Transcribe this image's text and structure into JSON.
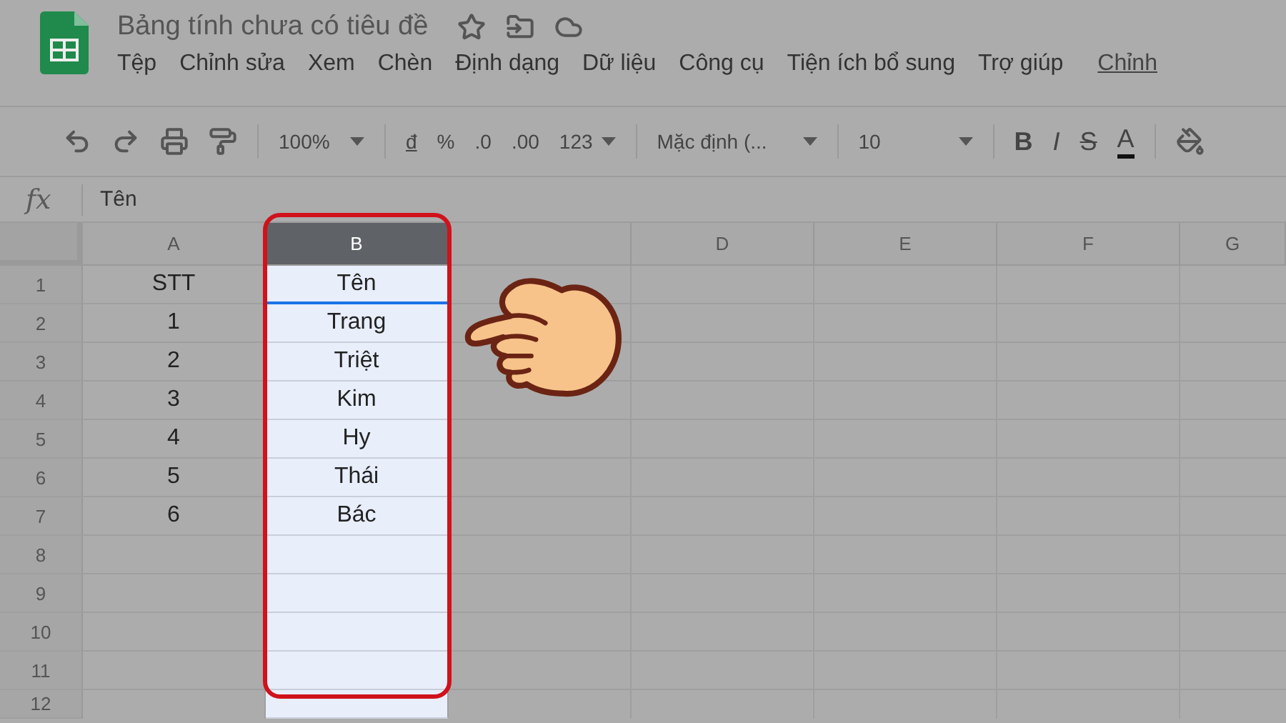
{
  "document": {
    "title": "Bảng tính chưa có tiêu đề"
  },
  "menu": [
    {
      "label": "Tệp"
    },
    {
      "label": "Chỉnh sửa"
    },
    {
      "label": "Xem"
    },
    {
      "label": "Chèn"
    },
    {
      "label": "Định dạng"
    },
    {
      "label": "Dữ liệu"
    },
    {
      "label": "Công cụ"
    },
    {
      "label": "Tiện ích bổ sung"
    },
    {
      "label": "Trợ giúp"
    }
  ],
  "edit_link": "Chỉnh",
  "toolbar": {
    "zoom": "100%",
    "currency": "đ",
    "percent": "%",
    "decrease_decimals": ".0",
    "increase_decimals": ".00",
    "number_format": "123",
    "font": "Mặc định (...",
    "font_size": "10",
    "bold": "B",
    "italic": "I",
    "strikethrough": "S",
    "text_color": "A"
  },
  "formula_bar": {
    "label": "fx",
    "value": "Tên"
  },
  "columns": [
    {
      "label": "A",
      "selected": false
    },
    {
      "label": "B",
      "selected": true
    },
    {
      "selected": false
    },
    {
      "label": "D",
      "selected": false
    },
    {
      "label": "E",
      "selected": false
    },
    {
      "label": "F",
      "selected": false
    },
    {
      "label": "G",
      "selected": false
    }
  ],
  "rows": [
    {
      "number": "1",
      "cells": [
        {
          "text": "STT",
          "active": false
        },
        {
          "text": "Tên",
          "active": true
        }
      ]
    },
    {
      "number": "2",
      "cells": [
        {
          "text": "1",
          "active": false
        },
        {
          "text": "Trang",
          "active": false
        }
      ]
    },
    {
      "number": "3",
      "cells": [
        {
          "text": "2",
          "active": false
        },
        {
          "text": "Triệt",
          "active": false
        }
      ]
    },
    {
      "number": "4",
      "cells": [
        {
          "text": "3",
          "active": false
        },
        {
          "text": "Kim",
          "active": false
        }
      ]
    },
    {
      "number": "5",
      "cells": [
        {
          "text": "4",
          "active": false
        },
        {
          "text": "Hy",
          "active": false
        }
      ]
    },
    {
      "number": "6",
      "cells": [
        {
          "text": "5",
          "active": false
        },
        {
          "text": "Thái",
          "active": false
        }
      ]
    },
    {
      "number": "7",
      "cells": [
        {
          "text": "6",
          "active": false
        },
        {
          "text": "Bác",
          "active": false
        }
      ]
    },
    {
      "number": "8",
      "cells": []
    },
    {
      "number": "9",
      "cells": []
    },
    {
      "number": "10",
      "cells": []
    },
    {
      "number": "11",
      "cells": []
    },
    {
      "number": "12",
      "cells": []
    }
  ]
}
